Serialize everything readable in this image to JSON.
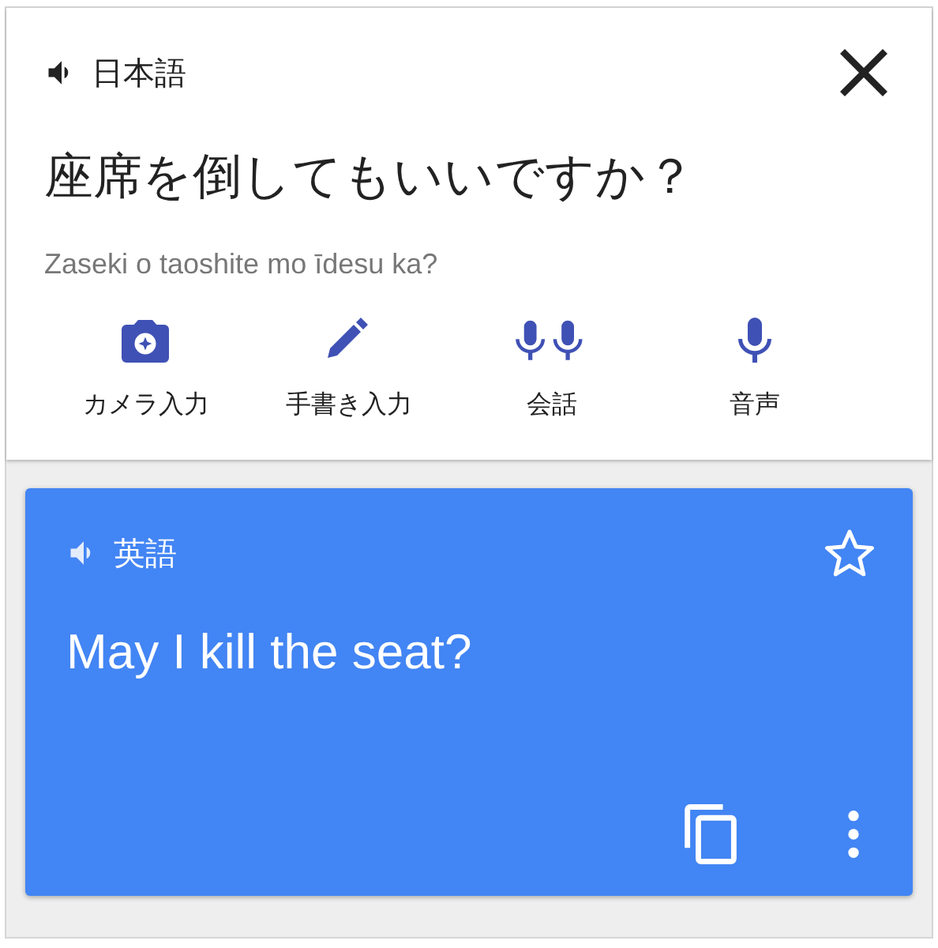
{
  "source": {
    "language": "日本語",
    "text": "座席を倒してもいいですか？",
    "romanization": "Zaseki o taoshite mo īdesu ka?"
  },
  "input_modes": [
    {
      "kind": "camera",
      "label": "カメラ入力"
    },
    {
      "kind": "handwriting",
      "label": "手書き入力"
    },
    {
      "kind": "conversation",
      "label": "会話"
    },
    {
      "kind": "voice",
      "label": "音声"
    }
  ],
  "translation": {
    "language": "英語",
    "text": "May I kill the seat?",
    "starred": false
  }
}
